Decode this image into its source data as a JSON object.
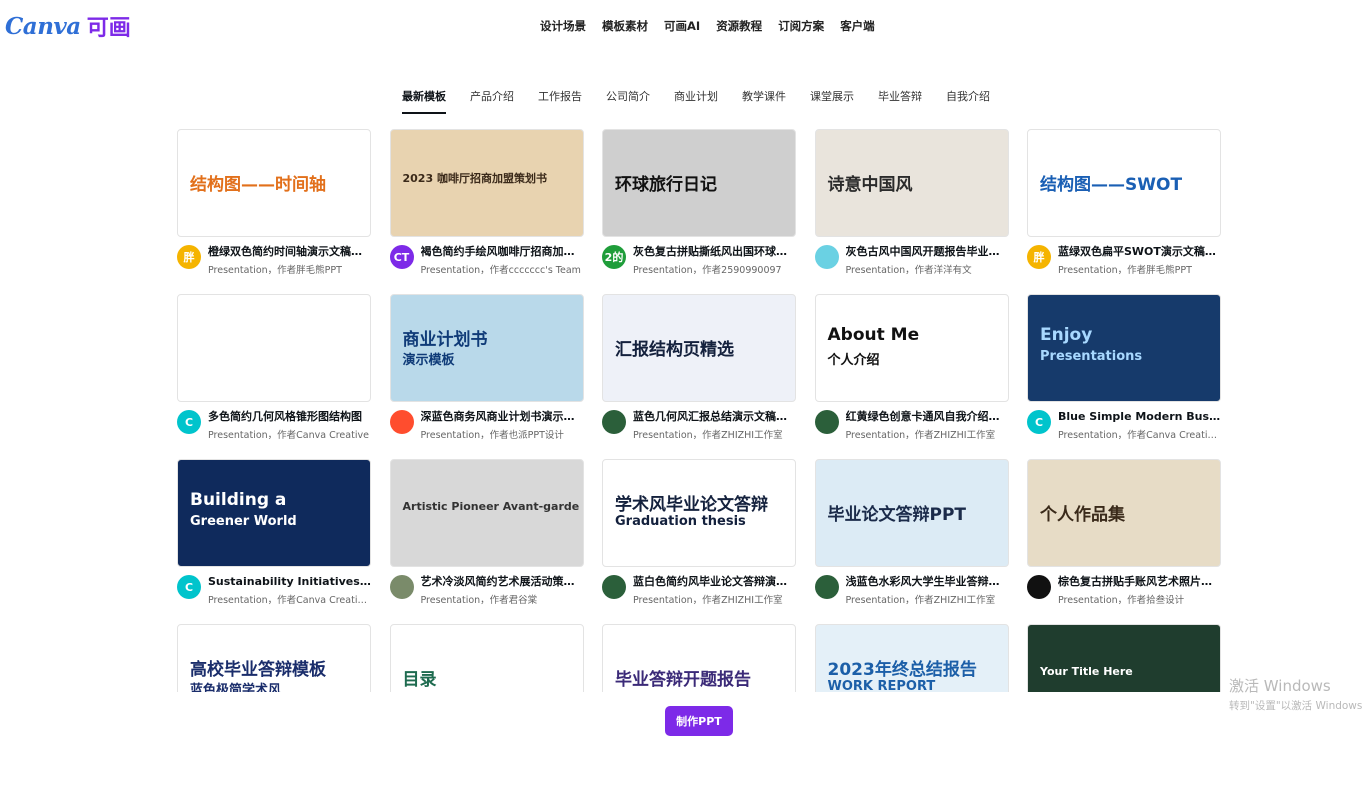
{
  "logo": {
    "text": "Canva",
    "cn": "可画"
  },
  "nav": [
    "设计场景",
    "模板素材",
    "可画AI",
    "资源教程",
    "订阅方案",
    "客户端"
  ],
  "tabs": [
    "最新模板",
    "产品介绍",
    "工作报告",
    "公司简介",
    "商业计划",
    "教学课件",
    "课堂展示",
    "毕业答辩",
    "自我介绍"
  ],
  "cards": [
    {
      "title": "橙绿双色简约时间轴演示文稿结构图",
      "sub": "Presentation，作者胖毛熊PPT",
      "avatar": "胖",
      "avatar_color": "#f5b400",
      "thumb_text": "结构图——时间轴",
      "thumb_text2": "",
      "bg": "#ffffff",
      "fg": "#e2701b"
    },
    {
      "title": "褐色简约手绘风咖啡厅招商加盟策划书",
      "sub": "Presentation，作者ccccccc's Team",
      "avatar": "CT",
      "avatar_color": "#7d2ae8",
      "thumb_text": "2023 咖啡厅招商加盟策划书",
      "thumb_text2": "",
      "bg": "#e8d3b0",
      "fg": "#3b2a1a"
    },
    {
      "title": "灰色复古拼贴撕纸风出国环球旅行日记",
      "sub": "Presentation，作者2590990097",
      "avatar": "2的",
      "avatar_color": "#1f9d3a",
      "thumb_text": "环球旅行日记",
      "thumb_text2": "",
      "bg": "#cfcfcf",
      "fg": "#111111"
    },
    {
      "title": "灰色古风中国风开题报告毕业答辩",
      "sub": "Presentation，作者洋洋有文",
      "avatar": "",
      "avatar_color": "#6ad1e3",
      "thumb_text": "诗意中国风",
      "thumb_text2": "",
      "bg": "#e9e4dc",
      "fg": "#2b2b2b"
    },
    {
      "title": "蓝绿双色扁平SWOT演示文稿结构图",
      "sub": "Presentation，作者胖毛熊PPT",
      "avatar": "胖",
      "avatar_color": "#f5b400",
      "thumb_text": "结构图——SWOT",
      "thumb_text2": "",
      "bg": "#ffffff",
      "fg": "#1a5fb4"
    },
    {
      "title": "多色简约几何风格锥形图结构图",
      "sub": "Presentation，作者Canva Creative",
      "avatar": "C",
      "avatar_color": "#00c4cc",
      "thumb_text": "",
      "thumb_text2": "",
      "bg": "#ffffff",
      "fg": "#8c52ff"
    },
    {
      "title": "深蓝色商务风商业计划书演示文稿",
      "sub": "Presentation，作者也派PPT设计",
      "avatar": "",
      "avatar_color": "#ff4d2e",
      "thumb_text": "商业计划书",
      "thumb_text2": "演示模板",
      "bg": "#b9d9ea",
      "fg": "#0f3b78"
    },
    {
      "title": "蓝色几何风汇报总结演示文稿结构图",
      "sub": "Presentation，作者ZHIZHI工作室",
      "avatar": "",
      "avatar_color": "#2b5f3a",
      "thumb_text": "汇报结构页精选",
      "thumb_text2": "",
      "bg": "#eef1f8",
      "fg": "#14213d"
    },
    {
      "title": "红黄绿色创意卡通风自我介绍求职演示",
      "sub": "Presentation，作者ZHIZHI工作室",
      "avatar": "",
      "avatar_color": "#2b5f3a",
      "thumb_text": "About  Me",
      "thumb_text2": "个人介绍",
      "bg": "#ffffff",
      "fg": "#111111"
    },
    {
      "title": "Blue Simple Modern Business Presentation",
      "sub": "Presentation，作者Canva Creative Studio",
      "avatar": "C",
      "avatar_color": "#00c4cc",
      "thumb_text": "Enjoy",
      "thumb_text2": "Presentations",
      "bg": "#163a6b",
      "fg": "#a8d8ff"
    },
    {
      "title": "Sustainability Initiatives Business Presentation",
      "sub": "Presentation，作者Canva Creative Studio",
      "avatar": "C",
      "avatar_color": "#00c4cc",
      "thumb_text": "Building a",
      "thumb_text2": "Greener World",
      "bg": "#0f2a5c",
      "fg": "#ffffff"
    },
    {
      "title": "艺术冷淡风简约艺术展活动策划方案",
      "sub": "Presentation，作者君谷棠",
      "avatar": "",
      "avatar_color": "#7a8b6a",
      "thumb_text": "Artistic Pioneer  Avant-garde",
      "thumb_text2": "",
      "bg": "#d8d8d8",
      "fg": "#333333"
    },
    {
      "title": "蓝白色简约风毕业论文答辩演示文稿",
      "sub": "Presentation，作者ZHIZHI工作室",
      "avatar": "",
      "avatar_color": "#2b5f3a",
      "thumb_text": "学术风毕业论文答辩",
      "thumb_text2": "Graduation thesis",
      "bg": "#ffffff",
      "fg": "#14213d"
    },
    {
      "title": "浅蓝色水彩风大学生毕业答辩演示文稿",
      "sub": "Presentation，作者ZHIZHI工作室",
      "avatar": "",
      "avatar_color": "#2b5f3a",
      "thumb_text": "毕业论文答辩PPT",
      "thumb_text2": "",
      "bg": "#dcebf5",
      "fg": "#1b2b4a"
    },
    {
      "title": "棕色复古拼贴手账风艺术照片作品集",
      "sub": "Presentation，作者拾叁设计",
      "avatar": "",
      "avatar_color": "#111111",
      "thumb_text": "个人作品集",
      "thumb_text2": "",
      "bg": "#e7dcc6",
      "fg": "#3a2a1a"
    },
    {
      "title": "",
      "sub": "",
      "avatar": "",
      "avatar_color": "#ffffff",
      "thumb_text": "高校毕业答辩模板",
      "thumb_text2": "蓝色极简学术风",
      "bg": "#ffffff",
      "fg": "#1a2d6b"
    },
    {
      "title": "",
      "sub": "",
      "avatar": "",
      "avatar_color": "#ffffff",
      "thumb_text": "目录",
      "thumb_text2": "",
      "bg": "#ffffff",
      "fg": "#1e6b4f"
    },
    {
      "title": "",
      "sub": "",
      "avatar": "",
      "avatar_color": "#ffffff",
      "thumb_text": "毕业答辩开题报告",
      "thumb_text2": "",
      "bg": "#ffffff",
      "fg": "#3b2a78"
    },
    {
      "title": "",
      "sub": "",
      "avatar": "",
      "avatar_color": "#ffffff",
      "thumb_text": "2023年终总结报告",
      "thumb_text2": "WORK REPORT",
      "bg": "#e4f0f8",
      "fg": "#1c5fa8"
    },
    {
      "title": "",
      "sub": "",
      "avatar": "",
      "avatar_color": "#ffffff",
      "thumb_text": "Your Title Here",
      "thumb_text2": "",
      "bg": "#1f3d2e",
      "fg": "#ffffff"
    }
  ],
  "cta": "制作PPT",
  "watermark": {
    "line1": "激活 Windows",
    "line2": "转到\"设置\"以激活 Windows"
  }
}
